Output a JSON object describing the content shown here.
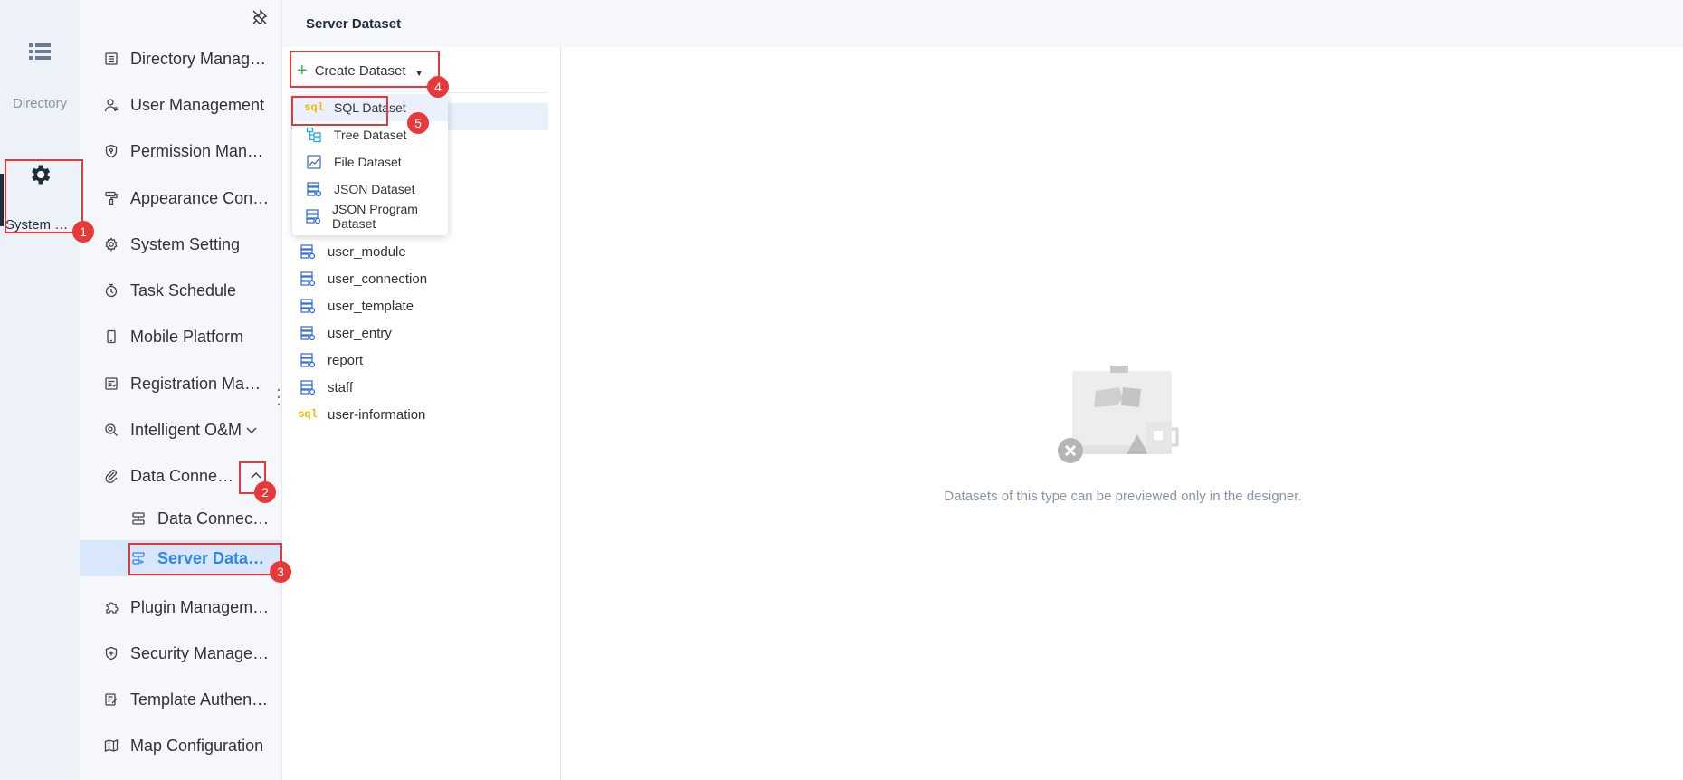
{
  "rail": {
    "directory": {
      "label": "Directory",
      "icon": "list-icon"
    },
    "system": {
      "label": "System Management",
      "icon": "gear-icon"
    }
  },
  "sidebar": {
    "items": [
      {
        "label": "Directory Management",
        "icon": "document-icon"
      },
      {
        "label": "User Management",
        "icon": "user-icon"
      },
      {
        "label": "Permission Management",
        "icon": "shield-icon"
      },
      {
        "label": "Appearance Configuration",
        "icon": "paint-roller-icon"
      },
      {
        "label": "System Setting",
        "icon": "gear-icon"
      },
      {
        "label": "Task Schedule",
        "icon": "stopwatch-icon"
      },
      {
        "label": "Mobile Platform",
        "icon": "phone-icon"
      },
      {
        "label": "Registration Management",
        "icon": "registration-icon"
      },
      {
        "label": "Intelligent O&M",
        "icon": "om-icon"
      },
      {
        "label": "Data Connection",
        "icon": "paperclip-icon"
      }
    ],
    "sub_items": [
      {
        "label": "Data Connection",
        "icon": "database-icon"
      },
      {
        "label": "Server Dataset",
        "icon": "server-dataset-icon"
      }
    ],
    "bottom_items": [
      {
        "label": "Plugin Management",
        "icon": "puzzle-icon"
      },
      {
        "label": "Security Management",
        "icon": "shield-plus-icon"
      },
      {
        "label": "Template Authentication",
        "icon": "template-auth-icon"
      },
      {
        "label": "Map Configuration",
        "icon": "map-icon"
      }
    ]
  },
  "header": {
    "title": "Server Dataset"
  },
  "toolbar": {
    "create_label": "Create Dataset"
  },
  "dropdown": {
    "items": [
      {
        "label": "SQL Dataset",
        "icon": "sql-icon",
        "badge": "sql"
      },
      {
        "label": "Tree Dataset",
        "icon": "tree-icon"
      },
      {
        "label": "File Dataset",
        "icon": "file-chart-icon"
      },
      {
        "label": "JSON Dataset",
        "icon": "json-icon"
      },
      {
        "label": "JSON Program Dataset",
        "icon": "json-program-icon"
      }
    ]
  },
  "datasets": [
    {
      "name": "user_module",
      "icon": "dataset-icon"
    },
    {
      "name": "user_connection",
      "icon": "dataset-icon"
    },
    {
      "name": "user_template",
      "icon": "dataset-icon"
    },
    {
      "name": "user_entry",
      "icon": "dataset-icon"
    },
    {
      "name": "report",
      "icon": "dataset-icon"
    },
    {
      "name": "staff",
      "icon": "dataset-icon"
    },
    {
      "name": "user-information",
      "icon": "sql-icon",
      "badge": "sql"
    }
  ],
  "preview": {
    "empty_text": "Datasets of this type can be previewed only in the designer."
  },
  "annotations": [
    "1",
    "2",
    "3",
    "4",
    "5"
  ],
  "colors": {
    "accent": "#2f86f0",
    "annotation": "#e03a3a",
    "sql": "#f5b400",
    "plus": "#39b54a"
  }
}
